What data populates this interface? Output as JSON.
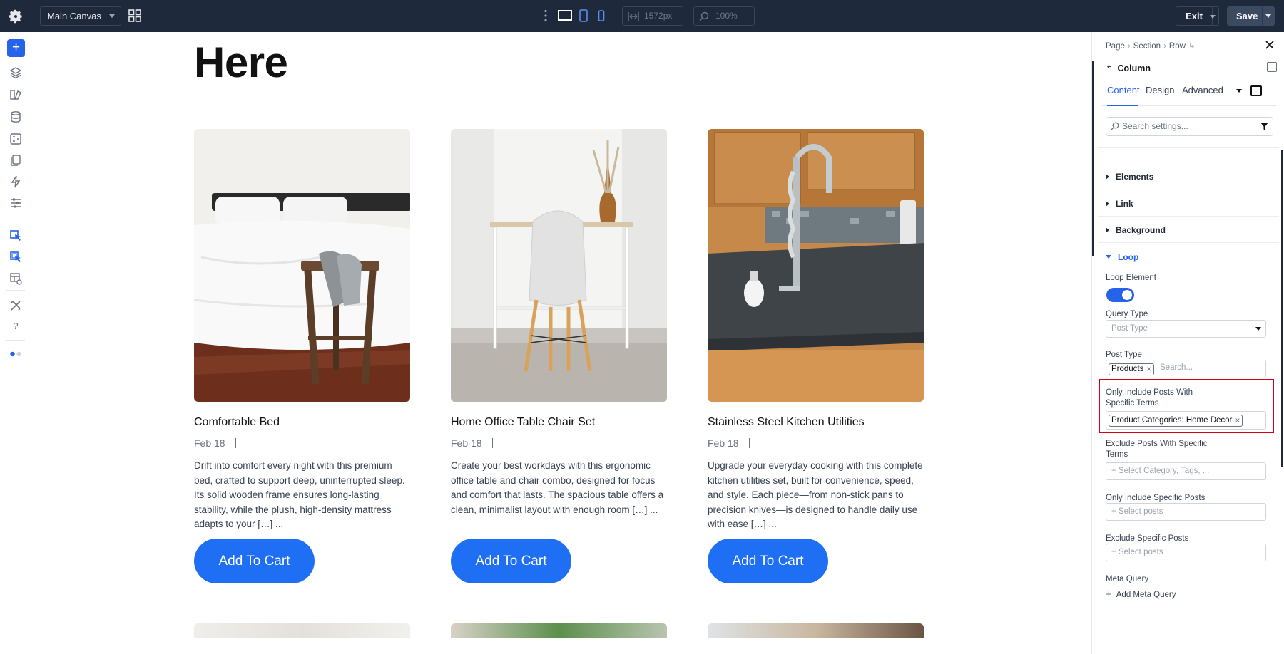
{
  "topbar": {
    "canvas_label": "Main Canvas",
    "width_value": "1572px",
    "zoom_value": "100%",
    "exit_label": "Exit",
    "save_label": "Save"
  },
  "hero": {
    "heading": "Here"
  },
  "cards": [
    {
      "title": "Comfortable Bed",
      "date": "Feb 18",
      "description": "Drift into comfort every night with this premium bed, crafted to support deep, uninterrupted sleep. Its solid wooden frame ensures long-lasting stability, while the plush, high-density mattress adapts to your […] ...",
      "button": "Add To Cart"
    },
    {
      "title": "Home Office Table Chair Set",
      "date": "Feb 18",
      "description": "Create your best workdays with this ergonomic office table and chair combo, designed for focus and comfort that lasts. The spacious table offers a clean, minimalist layout with enough room […] ...",
      "button": "Add To Cart"
    },
    {
      "title": "Stainless Steel Kitchen Utilities",
      "date": "Feb 18",
      "description": "Upgrade your everyday cooking with this complete kitchen utilities set, built for convenience, speed, and style. Each piece—from non-stick pans to precision knives—is designed to handle daily use with ease […] ...",
      "button": "Add To Cart"
    }
  ],
  "panel": {
    "breadcrumb": [
      "Page",
      "Section",
      "Row"
    ],
    "element_title": "Column",
    "tabs": [
      "Content",
      "Design",
      "Advanced"
    ],
    "search_placeholder": "Search settings...",
    "sections": [
      "Elements",
      "Link",
      "Background",
      "Loop"
    ],
    "loop": {
      "loop_element_label": "Loop Element",
      "loop_element_on": true,
      "query_type_label": "Query Type",
      "query_type_value": "Post Type",
      "post_type_label": "Post Type",
      "post_type_tag": "Products",
      "post_type_search": "Search...",
      "include_terms_label": "Only Include Posts With Specific Terms",
      "include_terms_tag": "Product Categories: Home Decor",
      "exclude_terms_label": "Exclude Posts With Specific Terms",
      "exclude_terms_placeholder": "+ Select Category, Tags, ...",
      "include_posts_label": "Only Include Specific Posts",
      "include_posts_placeholder": "+ Select posts",
      "exclude_posts_label": "Exclude Specific Posts",
      "exclude_posts_placeholder": "+ Select posts",
      "meta_query_label": "Meta Query",
      "add_meta_query": "Add Meta Query"
    }
  },
  "colors": {
    "topbar_bg": "#1e2a3b",
    "accent": "#2563eb",
    "cart_button": "#1e6ff4",
    "highlight_border": "#d0021b"
  }
}
